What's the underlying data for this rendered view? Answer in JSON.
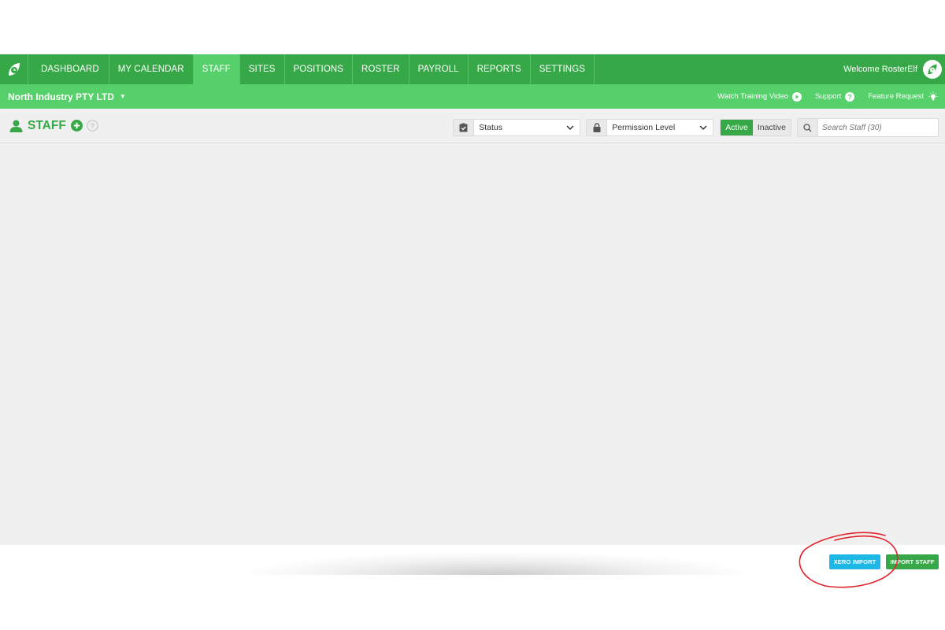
{
  "nav": {
    "items": [
      {
        "label": "DASHBOARD",
        "active": false
      },
      {
        "label": "MY CALENDAR",
        "active": false
      },
      {
        "label": "STAFF",
        "active": true
      },
      {
        "label": "SITES",
        "active": false
      },
      {
        "label": "POSITIONS",
        "active": false
      },
      {
        "label": "ROSTER",
        "active": false
      },
      {
        "label": "PAYROLL",
        "active": false
      },
      {
        "label": "REPORTS",
        "active": false
      },
      {
        "label": "SETTINGS",
        "active": false
      }
    ],
    "welcome": "Welcome RosterElf",
    "logo_icon": "leaf-clock-icon"
  },
  "subnav": {
    "company": "North Industry PTY LTD",
    "training": "Watch Training Video",
    "support": "Support",
    "feature": "Feature Request"
  },
  "toolbar": {
    "title": "STAFF",
    "status_select": "Status",
    "permission_select": "Permission Level",
    "active_label": "Active",
    "inactive_label": "Inactive",
    "search_placeholder": "Search Staff (30)"
  },
  "footer": {
    "xero_import": "XERO IMPORT",
    "import_staff": "IMPORT STAFF"
  },
  "colors": {
    "nav_green": "#37a847",
    "light_green": "#55d06a",
    "xero_blue": "#1fb8e6",
    "annotation_red": "#e2242c"
  }
}
